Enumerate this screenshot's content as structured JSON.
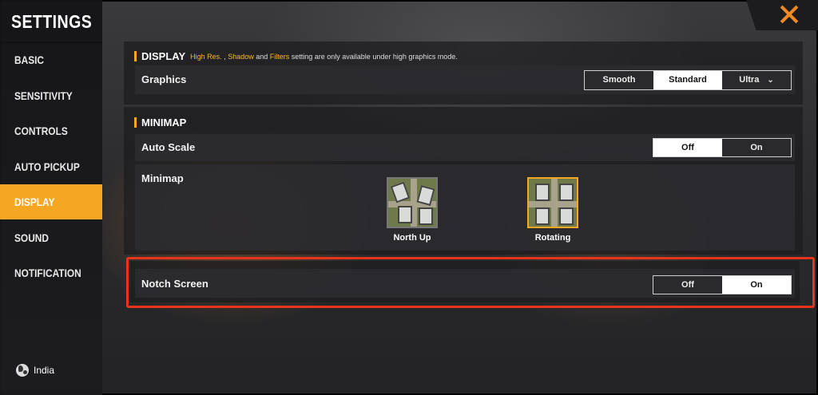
{
  "sidebar": {
    "title": "SETTINGS",
    "items": [
      {
        "label": "BASIC",
        "active": false
      },
      {
        "label": "SENSITIVITY",
        "active": false
      },
      {
        "label": "CONTROLS",
        "active": false
      },
      {
        "label": "AUTO PICKUP",
        "active": false
      },
      {
        "label": "DISPLAY",
        "active": true
      },
      {
        "label": "SOUND",
        "active": false
      },
      {
        "label": "NOTIFICATION",
        "active": false
      }
    ],
    "region": "India"
  },
  "display_section": {
    "heading": "DISPLAY",
    "note_part1": "High Res.",
    "note_part2": " , ",
    "note_part3": "Shadow",
    "note_part4": " and ",
    "note_part5": "Filters",
    "note_part6": " setting are only available under high graphics mode.",
    "graphics": {
      "label": "Graphics",
      "options": [
        "Smooth",
        "Standard",
        "Ultra"
      ],
      "selected": "Standard"
    }
  },
  "minimap_section": {
    "heading": "MINIMAP",
    "auto_scale": {
      "label": "Auto Scale",
      "options": [
        "Off",
        "On"
      ],
      "selected": "Off"
    },
    "minimap": {
      "label": "Minimap",
      "options": [
        "North Up",
        "Rotating"
      ],
      "selected": "Rotating"
    }
  },
  "notch_screen": {
    "label": "Notch Screen",
    "options": [
      "Off",
      "On"
    ],
    "selected": "On"
  },
  "colors": {
    "accent": "#f5a623",
    "highlight_box": "#e8341c",
    "close_icon": "#f08a24"
  },
  "icons": {
    "close": "close-icon",
    "globe": "globe-icon",
    "dropdown": "chevron-down-icon"
  }
}
